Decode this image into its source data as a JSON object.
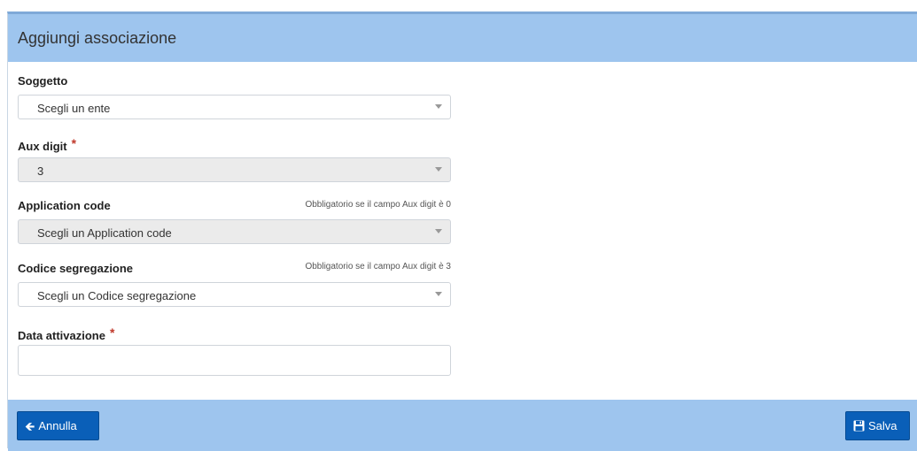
{
  "header": {
    "title": "Aggiungi associazione"
  },
  "form": {
    "soggetto": {
      "label": "Soggetto",
      "value": "Scegli un ente"
    },
    "aux_digit": {
      "label": "Aux digit",
      "required_mark": "*",
      "value": "3"
    },
    "application_code": {
      "label": "Application code",
      "hint": "Obbligatorio se il campo Aux digit è 0",
      "value": "Scegli un Application code"
    },
    "codice_segregazione": {
      "label": "Codice segregazione",
      "hint": "Obbligatorio se il campo Aux digit è 3",
      "value": "Scegli un Codice segregazione"
    },
    "data_attivazione": {
      "label": "Data attivazione",
      "required_mark": "*",
      "value": ""
    }
  },
  "footer": {
    "cancel_label": "Annulla",
    "save_label": "Salva"
  },
  "colors": {
    "header_bg": "#9ec5ee",
    "button_bg": "#0a5fb8",
    "required": "#c0392b"
  },
  "icons": {
    "cancel": "arrow-left-icon",
    "save": "floppy-disk-icon"
  }
}
